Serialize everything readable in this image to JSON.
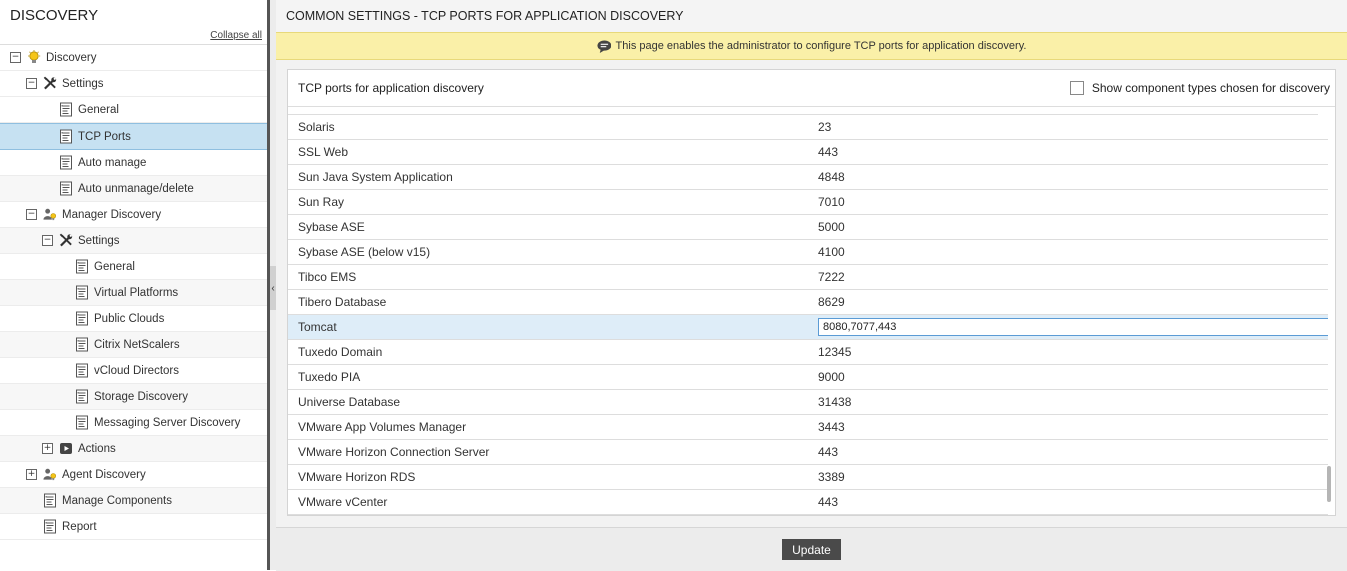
{
  "sidebar": {
    "title": "DISCOVERY",
    "collapse_all": "Collapse all",
    "tree": [
      {
        "label": "Discovery",
        "icon": "bulb-icon",
        "indent": 0,
        "toggle": "−",
        "alt": false,
        "selected": false
      },
      {
        "label": "Settings",
        "icon": "tools-icon",
        "indent": 1,
        "toggle": "−",
        "alt": false,
        "selected": false
      },
      {
        "label": "General",
        "icon": "document-icon",
        "indent": 2,
        "toggle": "",
        "alt": false,
        "selected": false
      },
      {
        "label": "TCP Ports",
        "icon": "document-icon",
        "indent": 2,
        "toggle": "",
        "alt": false,
        "selected": true
      },
      {
        "label": "Auto manage",
        "icon": "document-icon",
        "indent": 2,
        "toggle": "",
        "alt": false,
        "selected": false
      },
      {
        "label": "Auto unmanage/delete",
        "icon": "document-icon",
        "indent": 2,
        "toggle": "",
        "alt": true,
        "selected": false
      },
      {
        "label": "Manager Discovery",
        "icon": "user-bulb-icon",
        "indent": 1,
        "toggle": "−",
        "alt": false,
        "selected": false
      },
      {
        "label": "Settings",
        "icon": "tools-icon",
        "indent": 2,
        "toggle": "−",
        "alt": true,
        "selected": false
      },
      {
        "label": "General",
        "icon": "document-icon",
        "indent": 3,
        "toggle": "",
        "alt": false,
        "selected": false
      },
      {
        "label": "Virtual Platforms",
        "icon": "document-icon",
        "indent": 3,
        "toggle": "",
        "alt": true,
        "selected": false
      },
      {
        "label": "Public Clouds",
        "icon": "document-icon",
        "indent": 3,
        "toggle": "",
        "alt": false,
        "selected": false
      },
      {
        "label": "Citrix NetScalers",
        "icon": "document-icon",
        "indent": 3,
        "toggle": "",
        "alt": true,
        "selected": false
      },
      {
        "label": "vCloud Directors",
        "icon": "document-icon",
        "indent": 3,
        "toggle": "",
        "alt": false,
        "selected": false
      },
      {
        "label": "Storage Discovery",
        "icon": "document-icon",
        "indent": 3,
        "toggle": "",
        "alt": true,
        "selected": false
      },
      {
        "label": "Messaging Server Discovery",
        "icon": "document-icon",
        "indent": 3,
        "toggle": "",
        "alt": false,
        "selected": false
      },
      {
        "label": "Actions",
        "icon": "play-icon",
        "indent": 2,
        "toggle": "+",
        "alt": true,
        "selected": false
      },
      {
        "label": "Agent Discovery",
        "icon": "user-bulb-icon",
        "indent": 1,
        "toggle": "+",
        "alt": false,
        "selected": false
      },
      {
        "label": "Manage Components",
        "icon": "document-icon",
        "indent": 1,
        "toggle": "",
        "alt": true,
        "selected": false
      },
      {
        "label": "Report",
        "icon": "document-icon",
        "indent": 1,
        "toggle": "",
        "alt": false,
        "selected": false
      }
    ]
  },
  "main": {
    "page_title": "COMMON SETTINGS - TCP PORTS FOR APPLICATION DISCOVERY",
    "info_text": "This page enables the administrator to configure TCP ports for application discovery.",
    "panel_title": "TCP ports for application discovery",
    "show_component_label": "Show component types chosen for discovery",
    "rows": [
      {
        "name": "Solaris",
        "port": "23"
      },
      {
        "name": "SSL Web",
        "port": "443"
      },
      {
        "name": "Sun Java System Application",
        "port": "4848"
      },
      {
        "name": "Sun Ray",
        "port": "7010"
      },
      {
        "name": "Sybase ASE",
        "port": "5000"
      },
      {
        "name": "Sybase ASE (below v15)",
        "port": "4100"
      },
      {
        "name": "Tibco EMS",
        "port": "7222"
      },
      {
        "name": "Tibero Database",
        "port": "8629"
      },
      {
        "name": "Tomcat",
        "port": "8080,7077,443",
        "editing": true
      },
      {
        "name": "Tuxedo Domain",
        "port": "12345"
      },
      {
        "name": "Tuxedo PIA",
        "port": "9000"
      },
      {
        "name": "Universe Database",
        "port": "31438"
      },
      {
        "name": "VMware App Volumes Manager",
        "port": "3443"
      },
      {
        "name": "VMware Horizon Connection Server",
        "port": "443"
      },
      {
        "name": "VMware Horizon RDS",
        "port": "3389"
      },
      {
        "name": "VMware vCenter",
        "port": "443"
      }
    ],
    "update_label": "Update"
  },
  "colors": {
    "selected_row": "#c6e1f2",
    "info_bar": "#faf0a8",
    "button": "#4a4a4a",
    "bulb": "#f5c518"
  }
}
